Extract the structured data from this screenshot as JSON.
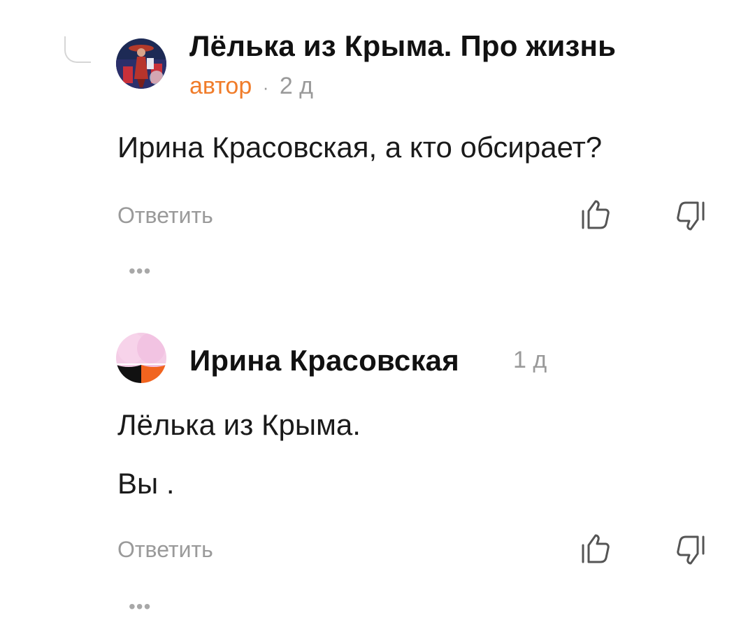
{
  "comments": [
    {
      "author": "Лёлька из Крыма. Про жизнь",
      "author_tag": "автор",
      "separator": "·",
      "time": "2 д",
      "text": [
        "Ирина Красовская, а кто обсирает?"
      ],
      "reply_label": "Ответить",
      "more_label": "•••"
    },
    {
      "author": "Ирина Красовская",
      "time": "1 д",
      "text": [
        "Лёлька из Крыма.",
        "Вы ."
      ],
      "reply_label": "Ответить",
      "more_label": "•••"
    }
  ],
  "icons": {
    "like": "thumbs-up-icon",
    "dislike": "thumbs-down-icon",
    "more": "more-dots-icon"
  },
  "colors": {
    "author_tag": "#f07c2a",
    "muted": "#9a9a9a",
    "text": "#1a1a1a"
  }
}
